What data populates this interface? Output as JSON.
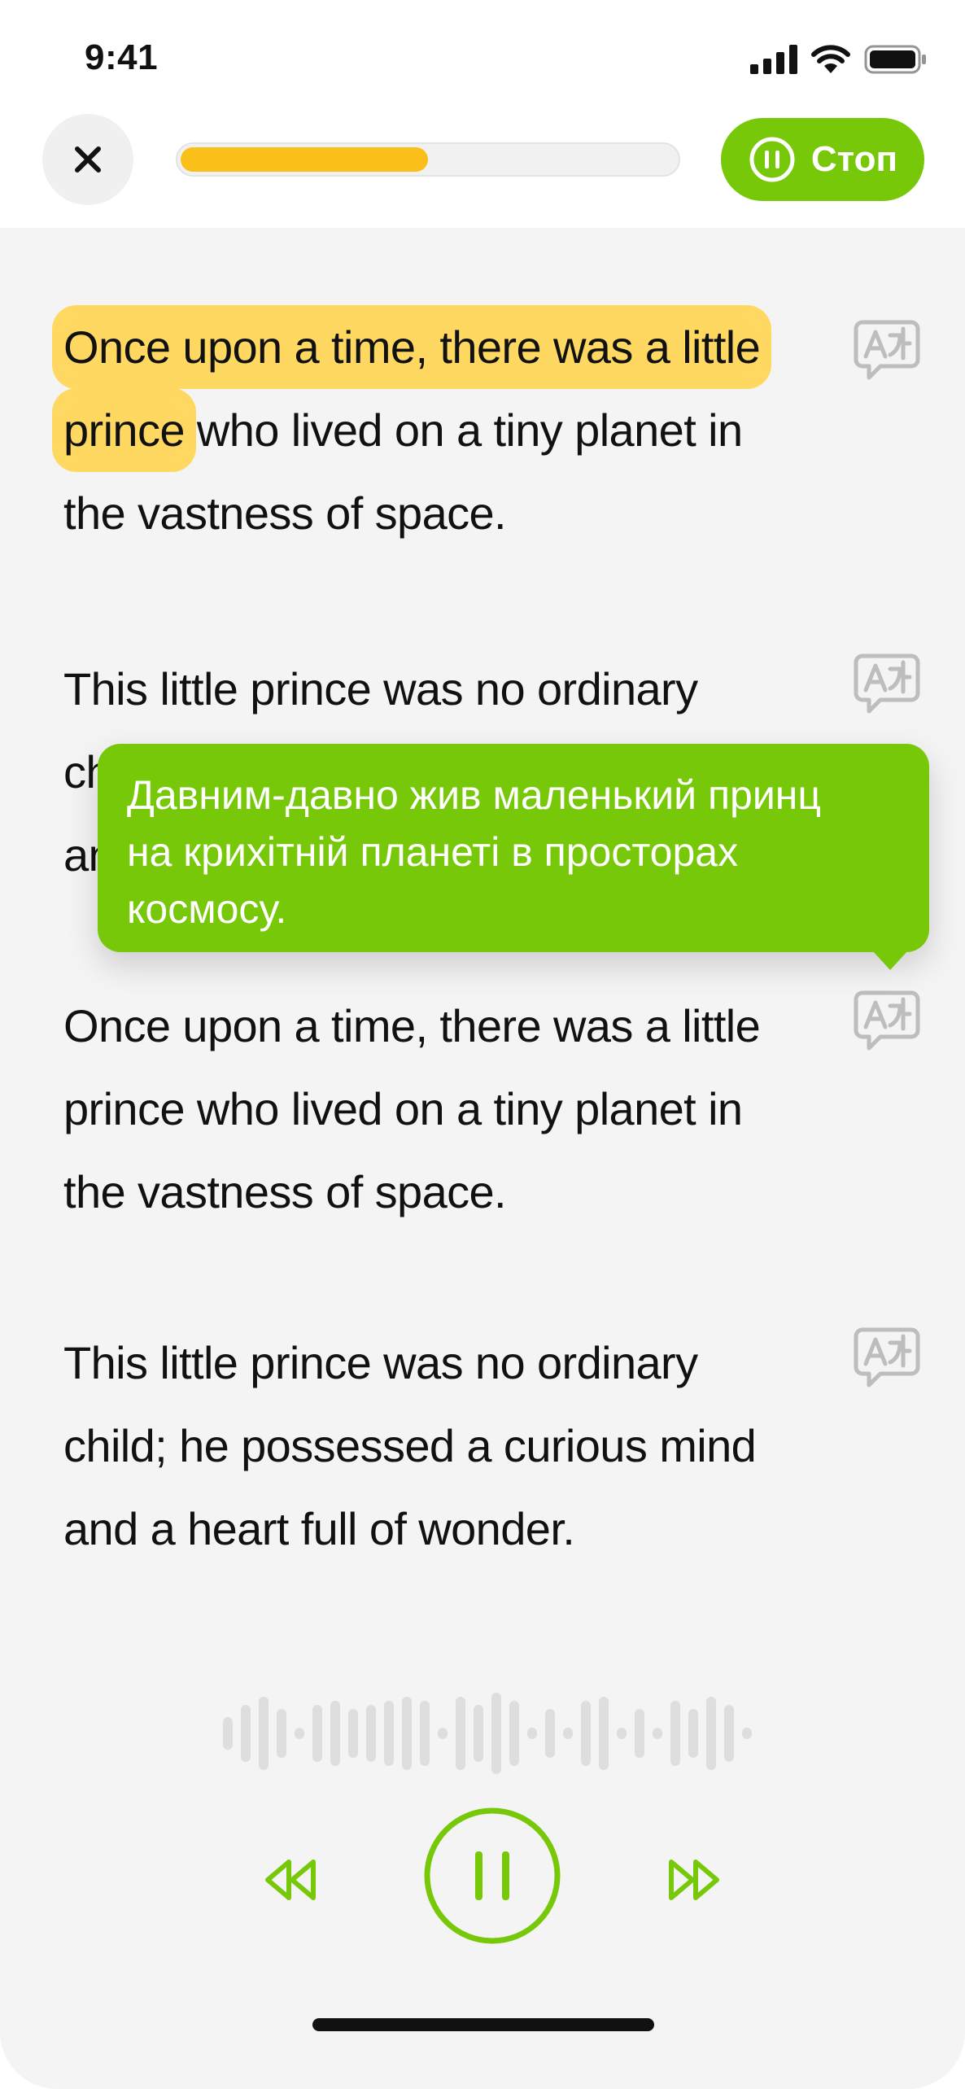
{
  "status_bar": {
    "time": "9:41"
  },
  "header": {
    "progress": 0.5,
    "stop_label": "Стоп"
  },
  "paragraphs": [
    {
      "highlight": "Once upon a time, there was a little prince",
      "text": " who lived on a tiny planet in the vastness of space."
    },
    {
      "text": "This little prince was no ordinary child; he possessed a curious mind and a heart full of wonder."
    },
    {
      "text": "Once upon a time, there was a little prince who lived on a tiny planet in the vastness of space."
    },
    {
      "text": "This little prince was no ordinary child; he possessed a curious mind and a heart full of wonder."
    }
  ],
  "tooltip": {
    "text": "Давним-давно жив маленький принц на крихітній планеті в просторах космосу."
  },
  "colors": {
    "accent": "#78c80a",
    "highlight": "#ffd861",
    "progress": "#fbbf1a"
  },
  "icons": [
    "close-icon",
    "pause-icon",
    "translate-icon",
    "rewind-icon",
    "fast-forward-icon",
    "signal-icon",
    "wifi-icon",
    "battery-icon"
  ]
}
